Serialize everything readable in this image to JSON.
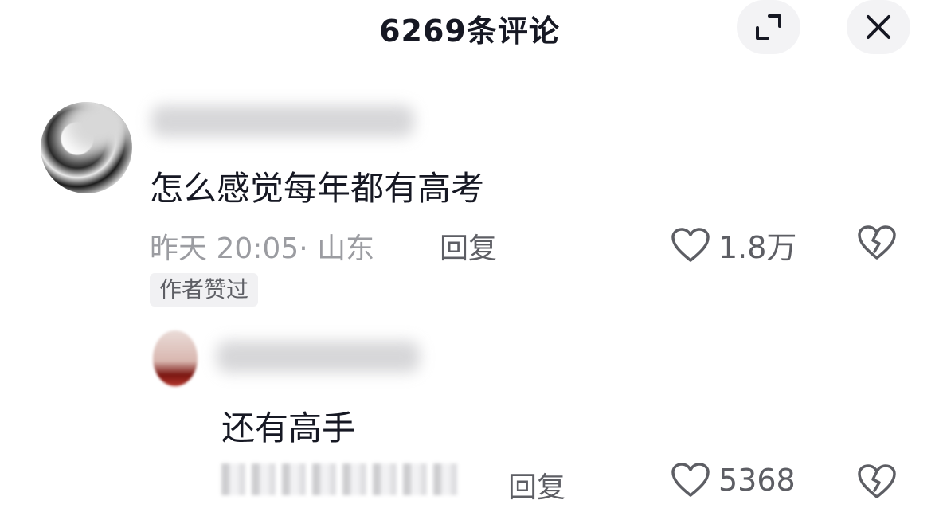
{
  "header": {
    "title": "6269条评论"
  },
  "controls": {
    "expand_icon": "expand-icon",
    "close_icon": "close-icon"
  },
  "comments": [
    {
      "text": "怎么感觉每年都有高考",
      "meta": "昨天 20:05· 山东",
      "reply_label": "回复",
      "likes": "1.8万",
      "badge": "作者赞过"
    },
    {
      "text": "还有高手",
      "reply_label": "回复",
      "likes": "5368"
    }
  ],
  "colors": {
    "text": "#161823",
    "meta": "#9b9ca1",
    "secondary": "#5d5e64",
    "button_bg": "#f3f3f5"
  }
}
